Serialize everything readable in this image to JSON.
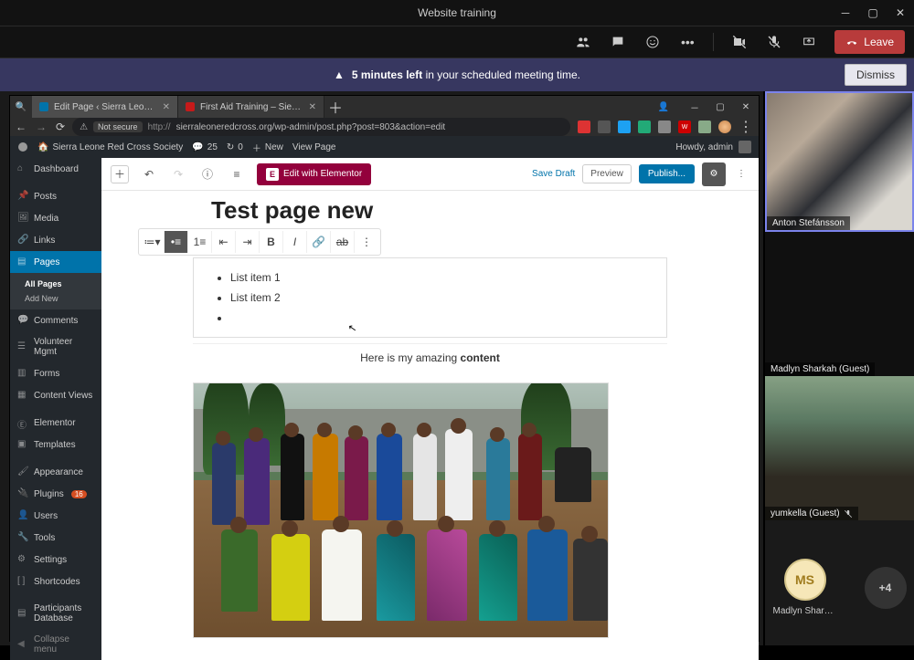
{
  "teams": {
    "title": "Website training",
    "leave_label": "Leave",
    "notice_bold": "5 minutes left",
    "notice_rest": " in your scheduled meeting time.",
    "dismiss_label": "Dismiss",
    "overflow_count": "+4",
    "participants": {
      "p1": "Anton Stefánsson",
      "p2": "Madlyn Sharkah (Guest)",
      "p3": "yumkella (Guest)",
      "p4": "Madlyn Sharka..."
    },
    "avatar_initials": "MS"
  },
  "browser": {
    "tab1": "Edit Page ‹ Sierra Leone Red Cros",
    "tab2": "First Aid Training – Sierra Leone R",
    "not_secure": "Not secure",
    "url": "sierraleoneredcross.org/wp-admin/post.php?post=803&action=edit"
  },
  "wp": {
    "site_name": "Sierra Leone Red Cross Society",
    "comment_count": "25",
    "pending_count": "0",
    "new_label": "New",
    "view_page_label": "View Page",
    "howdy": "Howdy, admin",
    "menu": {
      "dashboard": "Dashboard",
      "posts": "Posts",
      "media": "Media",
      "links": "Links",
      "pages": "Pages",
      "all_pages": "All Pages",
      "add_new": "Add New",
      "comments": "Comments",
      "volunteer": "Volunteer Mgmt",
      "forms": "Forms",
      "content_views": "Content Views",
      "elementor": "Elementor",
      "templates": "Templates",
      "appearance": "Appearance",
      "plugins": "Plugins",
      "plugins_badge": "16",
      "users": "Users",
      "tools": "Tools",
      "settings": "Settings",
      "shortcodes": "Shortcodes",
      "participants_db": "Participants Database",
      "collapse": "Collapse menu"
    },
    "editor": {
      "elementor_btn": "Edit with Elementor",
      "save_draft": "Save Draft",
      "preview": "Preview",
      "publish": "Publish...",
      "page_title": "Test page new",
      "list_item_1": "List item 1",
      "list_item_2": "List item 2",
      "para_prefix": "Here is my amazing ",
      "para_bold": "content"
    }
  }
}
